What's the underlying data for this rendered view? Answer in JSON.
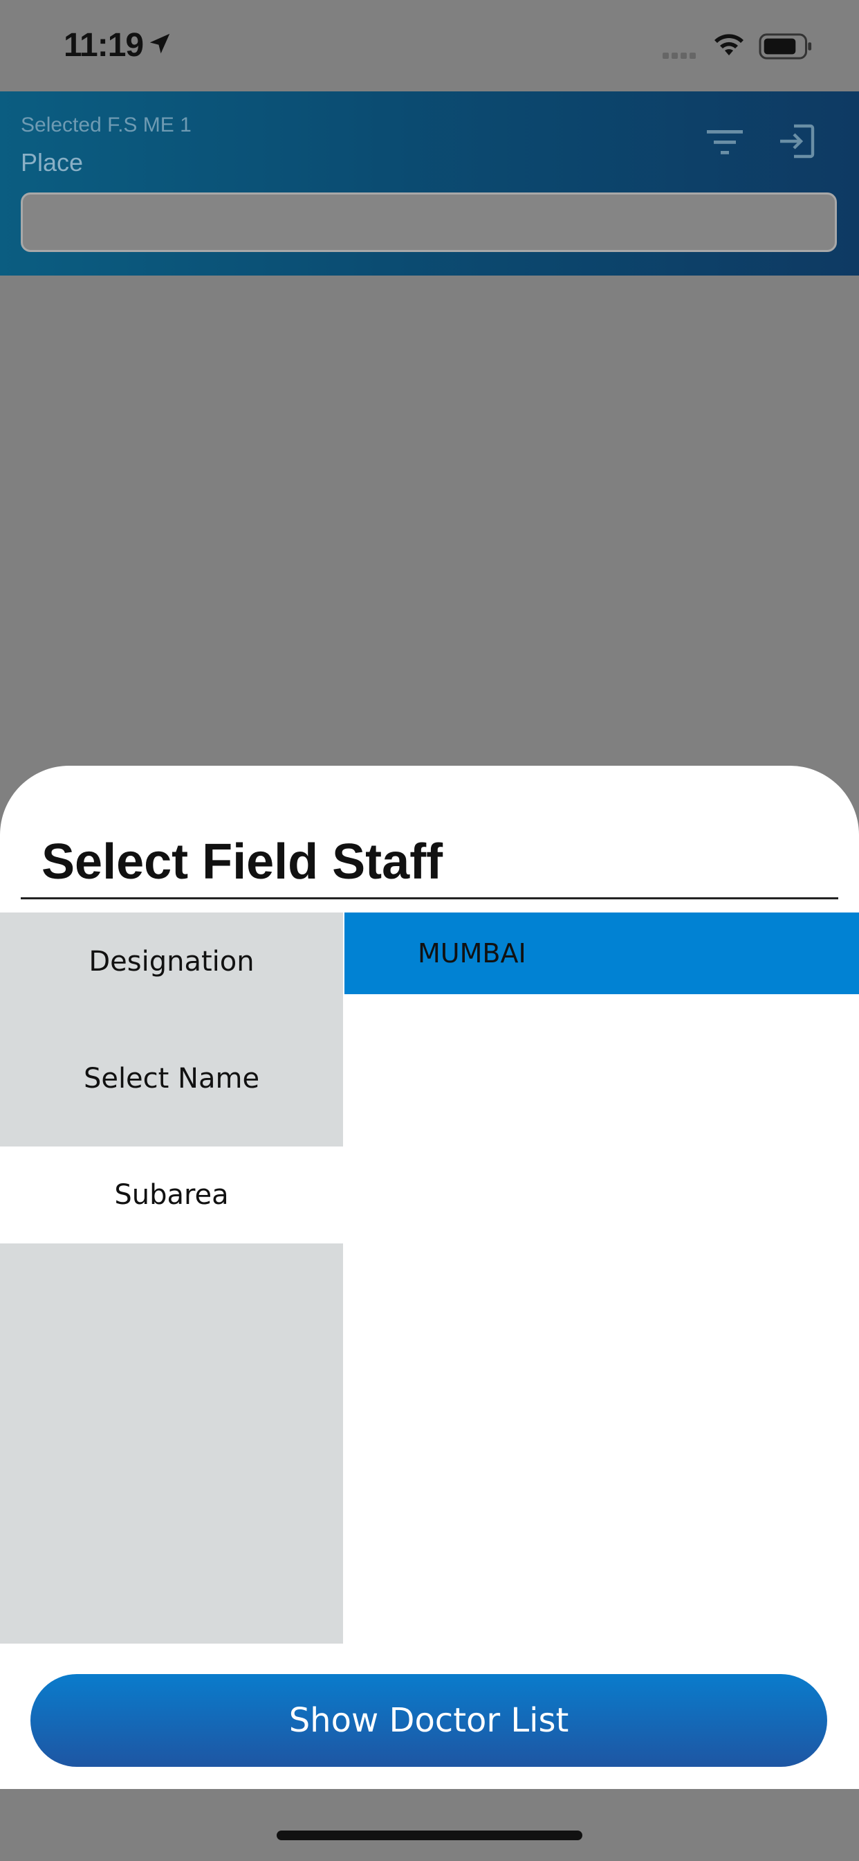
{
  "status_bar": {
    "time": "11:19",
    "icons": [
      "location-arrow-icon",
      "cell-signal-icon",
      "wifi-icon",
      "battery-icon"
    ]
  },
  "header": {
    "selected_fs": "Selected F.S ME 1",
    "place_label": "Place",
    "place_input_value": "",
    "icons": [
      "filter-icon",
      "exit-icon"
    ]
  },
  "sheet": {
    "title": "Select Field Staff",
    "left_items": [
      {
        "label": "Designation",
        "active": false
      },
      {
        "label": "Select Name",
        "active": false
      },
      {
        "label": "Subarea",
        "active": true
      }
    ],
    "options": [
      {
        "label": "MUMBAI",
        "selected": true
      }
    ],
    "button_label": "Show Doctor List"
  },
  "colors": {
    "header_gradient_start": "#0b5d81",
    "header_gradient_end": "#0e3a63",
    "selected_option": "#0182d3",
    "left_panel_bg": "#d7dadb",
    "button_top": "#0a7ccc",
    "button_bottom": "#1e56a3",
    "overlay": "#808080"
  }
}
